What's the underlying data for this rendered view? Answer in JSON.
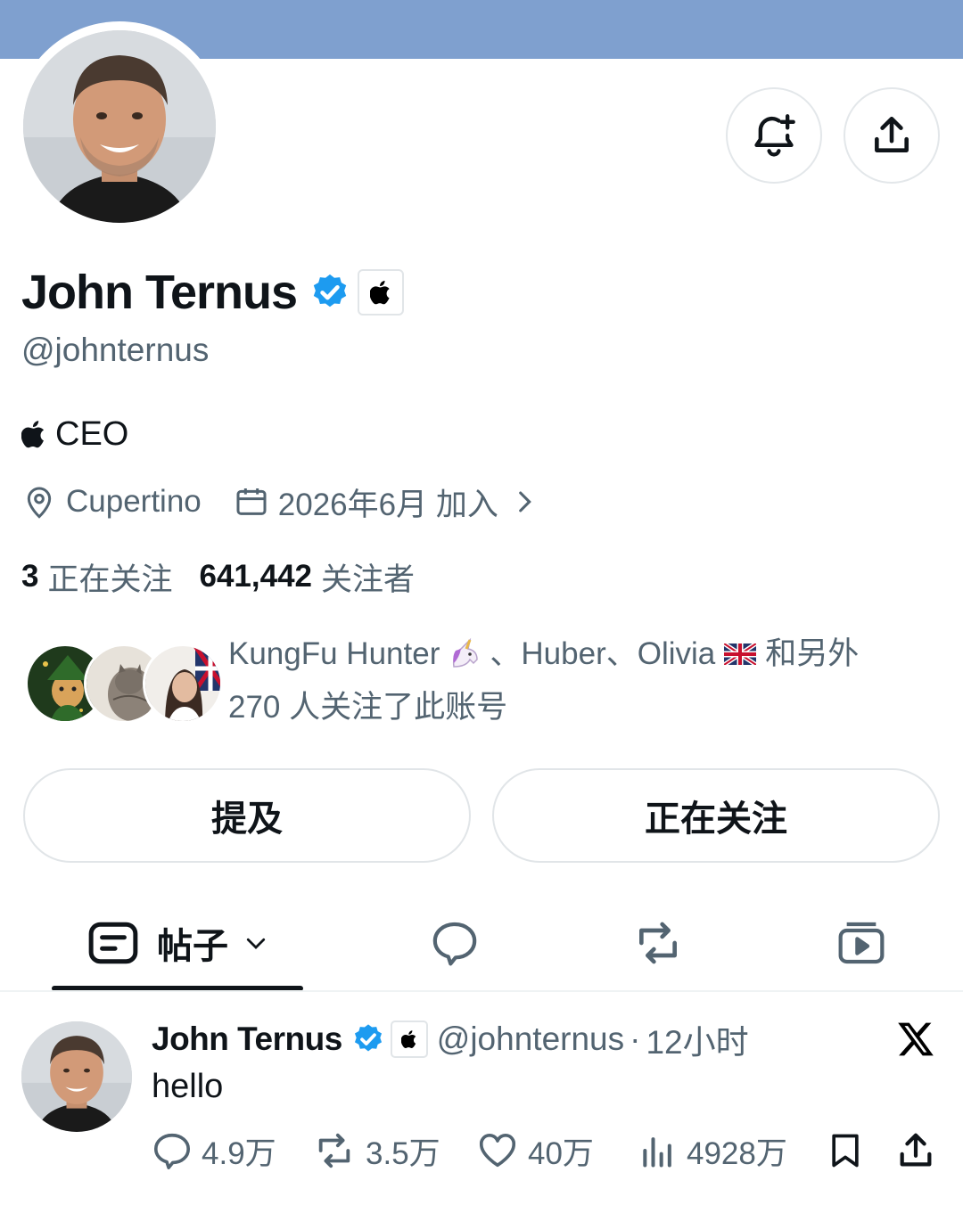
{
  "profile": {
    "name": "John Ternus",
    "handle": "@johnternus",
    "bio": "CEO",
    "location": "Cupertino",
    "joined": "2026年6月 加入",
    "following_count": "3",
    "following_label": "正在关注",
    "followers_count": "641,442",
    "followers_label": "关注者"
  },
  "mutuals": {
    "name1": "KungFu Hunter",
    "sep1": "、",
    "name2": "Huber",
    "sep2": "、",
    "name3": "Olivia",
    "suffix": "和另外",
    "line2": "270 人关注了此账号"
  },
  "buttons": {
    "mention": "提及",
    "following": "正在关注"
  },
  "tabs": {
    "posts_label": "帖子"
  },
  "post": {
    "name": "John Ternus",
    "handle": "@johnternus",
    "separator": "·",
    "time": "12小时",
    "text": "hello",
    "replies": "4.9万",
    "reposts": "3.5万",
    "likes": "40万",
    "views": "4928万"
  },
  "icons": {
    "verified": "verified-check-icon",
    "affiliation": "apple-logo-icon",
    "notify": "bell-plus-icon",
    "share": "share-icon",
    "location": "location-pin-icon",
    "calendar": "calendar-icon",
    "x": "x-logo-icon"
  },
  "colors": {
    "banner": "#7fa0cf",
    "verified": "#1d9bf0",
    "text": "#0f1419",
    "secondary": "#536471"
  }
}
